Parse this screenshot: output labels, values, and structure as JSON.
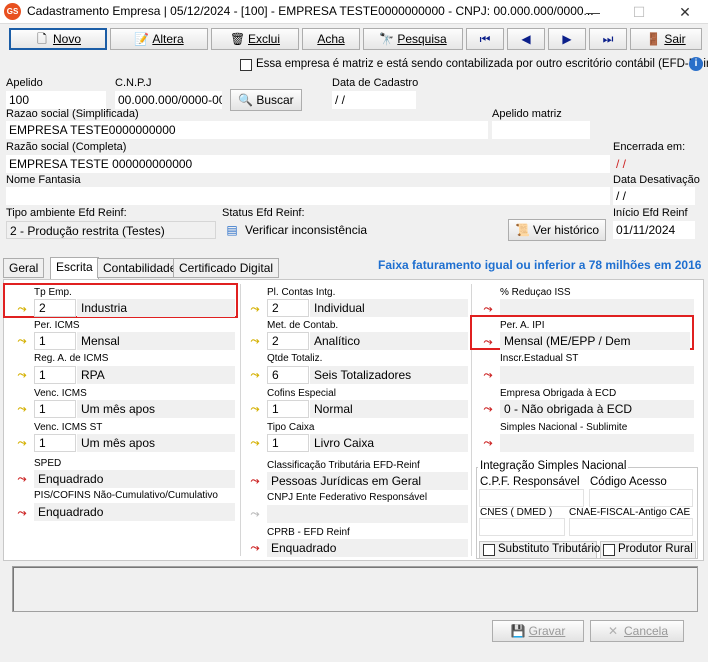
{
  "window": {
    "title": "Cadastramento Empresa |  05/12/2024 - [100] - EMPRESA TESTE0000000000 - CNPJ: 00.000.000/0000...",
    "app_icon": "GS",
    "minimize": "—",
    "maximize": "☐",
    "close": "✕"
  },
  "toolbar": {
    "novo": "Novo",
    "altera": "Altera",
    "exclui": "Exclui",
    "acha": "Acha",
    "pesquisa": "Pesquisa",
    "sair": "Sair"
  },
  "matriz_checkbox": "Essa empresa é matriz e está sendo contabilizada por outro escritório contábil (EFD-Reinf)",
  "form": {
    "apelido_label": "Apelido",
    "apelido": "100",
    "cnpj_label": "C.N.P.J",
    "cnpj": "00.000.000/0000-00",
    "buscar": "Buscar",
    "data_cadastro_label": "Data de Cadastro",
    "data_cadastro": "  /  /",
    "razao_simpl_label": "Razao social (Simplificada)",
    "razao_simpl": "EMPRESA TESTE0000000000",
    "apelido_matriz_label": "Apelido matriz",
    "razao_completa_label": "Razão social (Completa)",
    "razao_completa": "EMPRESA TESTE 000000000000",
    "encerrada_label": "Encerrada em:",
    "encerrada": "  /  /",
    "fantasia_label": "Nome Fantasia",
    "data_desativacao_label": "Data Desativação",
    "data_desativacao": "  /  /",
    "tipo_ambiente_label": "Tipo ambiente Efd Reinf:",
    "tipo_ambiente": "2 - Produção restrita (Testes)",
    "status_label": "Status Efd Reinf:",
    "verificar": "Verificar inconsistência",
    "ver_historico": "Ver histórico",
    "inicio_label": "Início Efd Reinf",
    "inicio": "01/11/2024"
  },
  "tabs": [
    "Geral",
    "Escrita",
    "Contabilidade",
    "Certificado Digital"
  ],
  "faixa_notice": "Faixa faturamento igual ou inferior a 78 milhões em 2016",
  "col1": [
    {
      "label": "Tp Emp.",
      "code": "2",
      "desc": "Industria",
      "arrow": "yellow"
    },
    {
      "label": "Per. ICMS",
      "code": "1",
      "desc": "Mensal",
      "arrow": "yellow"
    },
    {
      "label": "Reg.  A. de ICMS",
      "code": "1",
      "desc": "RPA",
      "arrow": "yellow"
    },
    {
      "label": "Venc. ICMS",
      "code": "1",
      "desc": "Um mês apos",
      "arrow": "yellow"
    },
    {
      "label": "Venc. ICMS ST",
      "code": "1",
      "desc": "Um mês apos",
      "arrow": "yellow"
    },
    {
      "label": "SPED",
      "desc": "Enquadrado",
      "arrow": "red"
    },
    {
      "label": "PIS/COFINS Não-Cumulativo/Cumulativo",
      "desc": "Enquadrado",
      "arrow": "red"
    }
  ],
  "col2": [
    {
      "label": "Pl.  Contas Intg.",
      "code": "2",
      "desc": "Individual",
      "arrow": "yellow"
    },
    {
      "label": "Met. de Contab.",
      "code": "2",
      "desc": "Analítico",
      "arrow": "yellow"
    },
    {
      "label": "Qtde Totaliz.",
      "code": "6",
      "desc": "Seis Totalizadores",
      "arrow": "yellow"
    },
    {
      "label": "Cofins Especial",
      "code": "1",
      "desc": "Normal",
      "arrow": "yellow"
    },
    {
      "label": "Tipo Caixa",
      "code": "1",
      "desc": "Livro Caixa",
      "arrow": "yellow"
    },
    {
      "label": "Classificação Tributária EFD-Reinf",
      "desc": "Pessoas Jurídicas em Geral",
      "arrow": "red"
    },
    {
      "label": "CNPJ Ente Federativo Responsável",
      "desc": "",
      "arrow": "gray"
    },
    {
      "label": "CPRB - EFD Reinf",
      "desc": "Enquadrado",
      "arrow": "red"
    }
  ],
  "col3": [
    {
      "label": "% Reduçao ISS",
      "desc": "",
      "arrow": "red"
    },
    {
      "label": "Per. A.  IPI",
      "desc": "Mensal (ME/EPP / Dem",
      "arrow": "red"
    },
    {
      "label": "Inscr.Estadual ST",
      "desc": "",
      "arrow": "red"
    },
    {
      "label": "Empresa Obrigada à ECD",
      "desc": "0 - Não obrigada à ECD",
      "arrow": "red"
    },
    {
      "label": "Simples Nacional - Sublimite",
      "desc": "",
      "arrow": "red"
    }
  ],
  "simples": {
    "title": "Integração Simples Nacional",
    "cpf_label": "C.P.F. Responsável",
    "codigo_label": "Código Acesso",
    "cnes_label": "CNES ( DMED )",
    "cnae_label": "CNAE-FISCAL-Antigo CAE",
    "substituto": "Substituto Tributário",
    "produtor": "Produtor Rural"
  },
  "footer": {
    "gravar": "Gravar",
    "cancela": "Cancela"
  }
}
